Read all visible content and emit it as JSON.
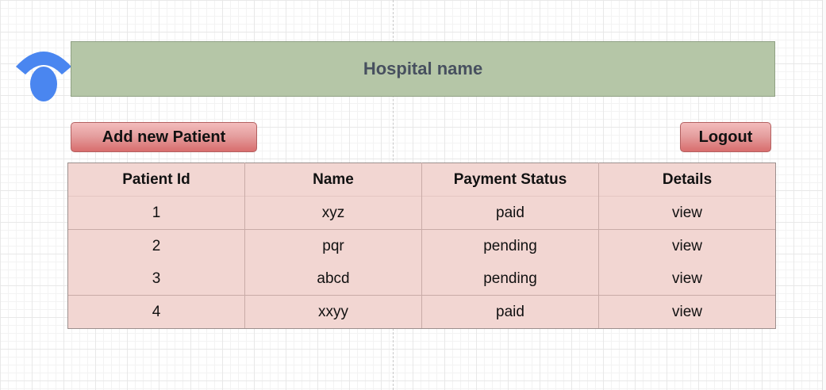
{
  "header": {
    "title": "Hospital name"
  },
  "logo": {
    "icon": "logo-icon",
    "color": "#4a86f0"
  },
  "toolbar": {
    "add_label": "Add new Patient",
    "logout_label": "Logout"
  },
  "table": {
    "columns": [
      "Patient Id",
      "Name",
      "Payment Status",
      "Details"
    ],
    "rows": [
      [
        "1",
        "xyz",
        "paid",
        "view"
      ],
      [
        "2",
        "pqr",
        "pending",
        "view"
      ],
      [
        "3",
        "abcd",
        "pending",
        "view"
      ],
      [
        "4",
        "xxyy",
        "paid",
        "view"
      ]
    ]
  },
  "colors": {
    "header_bg": "#b5c6a7",
    "button_bg": "#e59f9f",
    "table_bg": "#f2d6d2"
  }
}
